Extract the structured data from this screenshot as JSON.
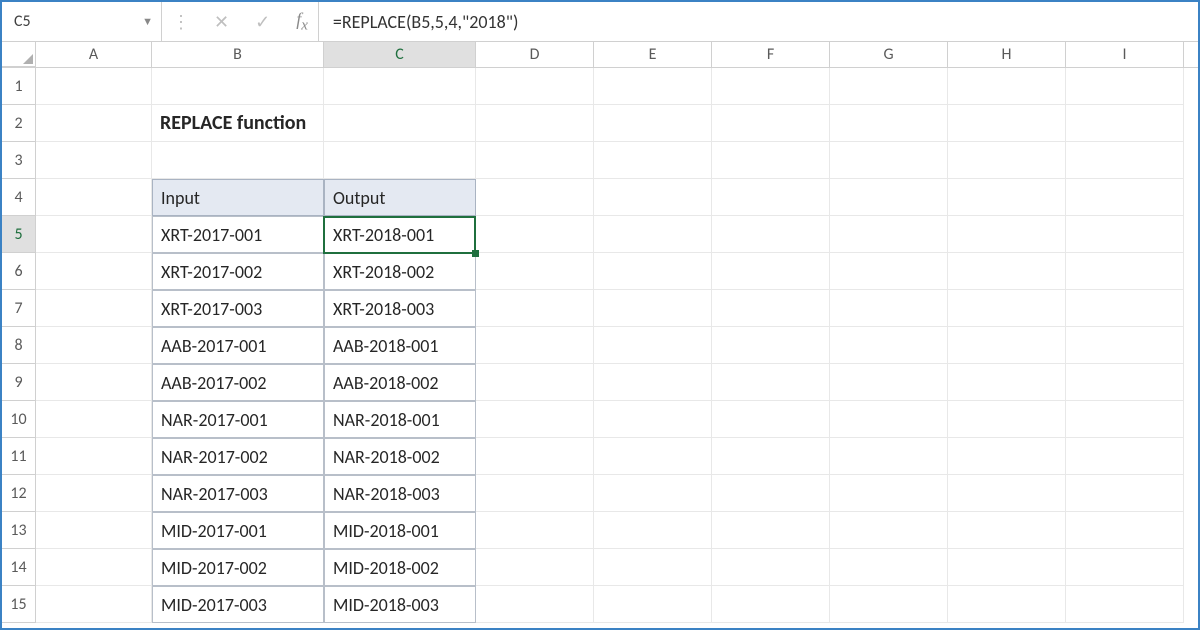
{
  "name_box": {
    "value": "C5"
  },
  "formula_bar": {
    "formula": "=REPLACE(B5,5,4,\"2018\")"
  },
  "columns": [
    "A",
    "B",
    "C",
    "D",
    "E",
    "F",
    "G",
    "H",
    "I"
  ],
  "active_column": "C",
  "active_row": 5,
  "row_numbers": [
    1,
    2,
    3,
    4,
    5,
    6,
    7,
    8,
    9,
    10,
    11,
    12,
    13,
    14,
    15
  ],
  "sheet": {
    "title": "REPLACE function",
    "headers": {
      "input": "Input",
      "output": "Output"
    },
    "rows": [
      {
        "input": "XRT-2017-001",
        "output": "XRT-2018-001"
      },
      {
        "input": "XRT-2017-002",
        "output": "XRT-2018-002"
      },
      {
        "input": "XRT-2017-003",
        "output": "XRT-2018-003"
      },
      {
        "input": "AAB-2017-001",
        "output": "AAB-2018-001"
      },
      {
        "input": "AAB-2017-002",
        "output": "AAB-2018-002"
      },
      {
        "input": "NAR-2017-001",
        "output": "NAR-2018-001"
      },
      {
        "input": "NAR-2017-002",
        "output": "NAR-2018-002"
      },
      {
        "input": "NAR-2017-003",
        "output": "NAR-2018-003"
      },
      {
        "input": "MID-2017-001",
        "output": "MID-2018-001"
      },
      {
        "input": "MID-2017-002",
        "output": "MID-2018-002"
      },
      {
        "input": "MID-2017-003",
        "output": "MID-2018-003"
      }
    ]
  }
}
